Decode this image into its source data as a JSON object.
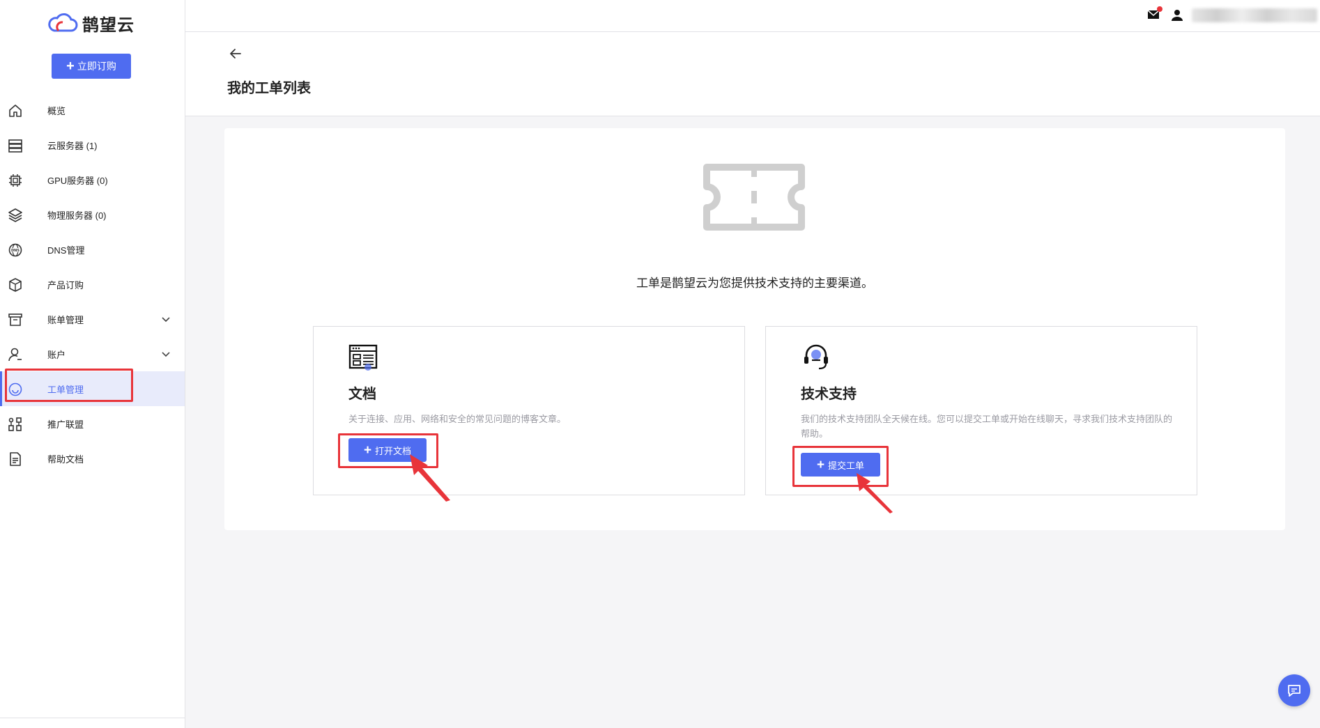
{
  "brand": {
    "name": "鹊望云"
  },
  "sidebar": {
    "order_button": "立即订购",
    "items": [
      {
        "label": "概览",
        "icon": "home-icon"
      },
      {
        "label": "云服务器 (1)",
        "icon": "server-icon"
      },
      {
        "label": "GPU服务器 (0)",
        "icon": "chip-icon"
      },
      {
        "label": "物理服务器 (0)",
        "icon": "layers-icon"
      },
      {
        "label": "DNS管理",
        "icon": "dns-globe-icon"
      },
      {
        "label": "产品订购",
        "icon": "box-icon"
      },
      {
        "label": "账单管理",
        "icon": "billing-icon",
        "expandable": true
      },
      {
        "label": "账户",
        "icon": "user-account-icon",
        "expandable": true
      },
      {
        "label": "工单管理",
        "icon": "smile-icon",
        "active": true
      },
      {
        "label": "推广联盟",
        "icon": "affiliate-icon"
      },
      {
        "label": "帮助文档",
        "icon": "document-icon"
      }
    ]
  },
  "topbar": {
    "mail_icon": "mail-icon",
    "user_icon": "user-icon"
  },
  "page": {
    "title": "我的工单列表"
  },
  "main": {
    "intro": "工单是鹊望云为您提供技术支持的主要渠道。",
    "panels": {
      "docs": {
        "title": "文档",
        "description": "关于连接、应用、网络和安全的常见问题的博客文章。",
        "button": "打开文档",
        "icon": "browser-window-icon"
      },
      "support": {
        "title": "技术支持",
        "description": "我们的技术支持团队全天候在线。您可以提交工单或开始在线聊天，寻求我们技术支持团队的帮助。",
        "button": "提交工单",
        "icon": "headset-icon"
      }
    }
  },
  "colors": {
    "accent": "#4f6cf0",
    "highlight": "#e8343a"
  }
}
